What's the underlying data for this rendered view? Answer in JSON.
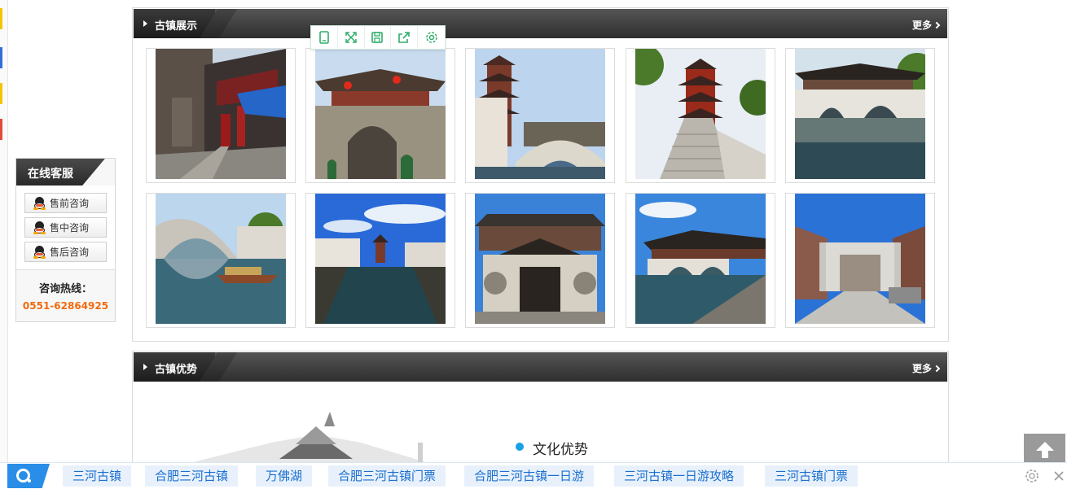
{
  "customer_service": {
    "title": "在线客服",
    "buttons": [
      "售前咨询",
      "售中咨询",
      "售后咨询"
    ],
    "hotline_label": "咨询热线：",
    "hotline_number": "0551-62864925"
  },
  "gallery_panel": {
    "title": "古镇展示",
    "more": "更多",
    "images": [
      {
        "icon": "old-street-photo"
      },
      {
        "icon": "town-gate-photo"
      },
      {
        "icon": "pagoda-bridge-photo"
      },
      {
        "icon": "pagoda-steps-photo"
      },
      {
        "icon": "pavilion-bridge-photo"
      },
      {
        "icon": "arch-bridge-boat-photo"
      },
      {
        "icon": "canal-photo"
      },
      {
        "icon": "temple-facade-photo"
      },
      {
        "icon": "bridge-pavilion-photo"
      },
      {
        "icon": "memorial-arch-photo"
      }
    ]
  },
  "image_toolbar": {
    "icons": [
      "phone-icon",
      "expand-icon",
      "save-icon",
      "share-icon",
      "settings-icon"
    ]
  },
  "advantage_panel": {
    "title": "古镇优势",
    "more": "更多",
    "section_title": "文化优势"
  },
  "bottom_bar": {
    "keywords": [
      "三河古镇",
      "合肥三河古镇",
      "万佛湖",
      "合肥三河古镇门票",
      "合肥三河古镇一日游",
      "三河古镇一日游攻略",
      "三河古镇门票"
    ]
  },
  "colors": {
    "header_dark": "#2e2e2e",
    "hotline": "#f06a0f",
    "accent_blue": "#2a8ee8",
    "keyword_bg": "#e8f1fb",
    "toolbar_green": "#2fae6a"
  }
}
